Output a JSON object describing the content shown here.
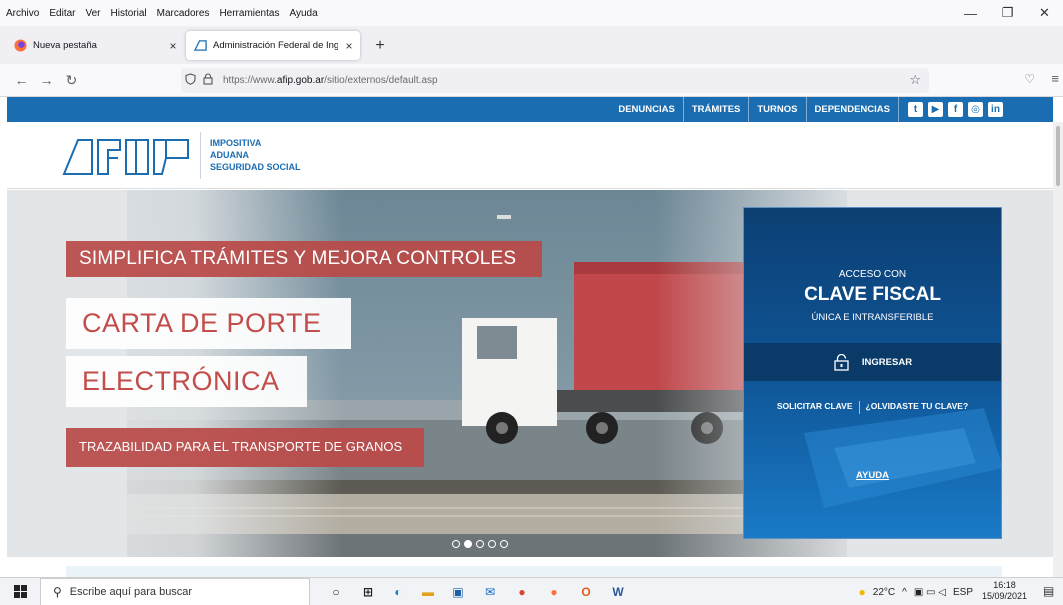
{
  "menubar": {
    "items": [
      "Archivo",
      "Editar",
      "Ver",
      "Historial",
      "Marcadores",
      "Herramientas",
      "Ayuda"
    ]
  },
  "window_controls": {
    "minimize": "—",
    "maximize": "❐",
    "close": "✕"
  },
  "tabs": [
    {
      "title": "Nueva pestaña",
      "close": "×"
    },
    {
      "title": "Administración Federal de Ingre",
      "close": "×"
    }
  ],
  "new_tab": "+",
  "navbar": {
    "back": "←",
    "forward": "→",
    "reload": "↻",
    "url_prefix": "https://www.",
    "url_domain": "afip.gob.ar",
    "url_path": "/sitio/externos/default.asp",
    "bookmark": "☆",
    "pocket": "♡",
    "menu": "≡"
  },
  "site": {
    "nav": [
      "DENUNCIAS",
      "TRÁMITES",
      "TURNOS",
      "DEPENDENCIAS"
    ],
    "social": [
      "t",
      "▶",
      "f",
      "◎",
      "in"
    ],
    "logo_words": [
      "IMPOSITIVA",
      "ADUANA",
      "SEGURIDAD SOCIAL"
    ],
    "hero": {
      "tag1": "SIMPLIFICA TRÁMITES Y MEJORA CONTROLES",
      "tag2": "CARTA DE PORTE",
      "tag3": "ELECTRÓNICA",
      "tag4": "TRAZABILIDAD PARA EL TRANSPORTE DE GRANOS"
    },
    "login": {
      "acceso": "ACCESO CON",
      "clave": "CLAVE FISCAL",
      "unica": "ÚNICA E INTRANSFERIBLE",
      "ingresar": "INGRESAR",
      "solicitar": "SOLICITAR CLAVE",
      "olvidaste": "¿OLVIDASTE TU CLAVE?",
      "ayuda": "AYUDA"
    }
  },
  "taskbar": {
    "search_placeholder": "Escribe aquí para buscar",
    "temp": "22°C",
    "lang": "ESP",
    "time": "16:18",
    "date": "15/09/2021"
  },
  "colors": {
    "site_blue": "#1b6db1",
    "hero_red": "#b94a48",
    "login_blue": "#0f4f8c"
  }
}
